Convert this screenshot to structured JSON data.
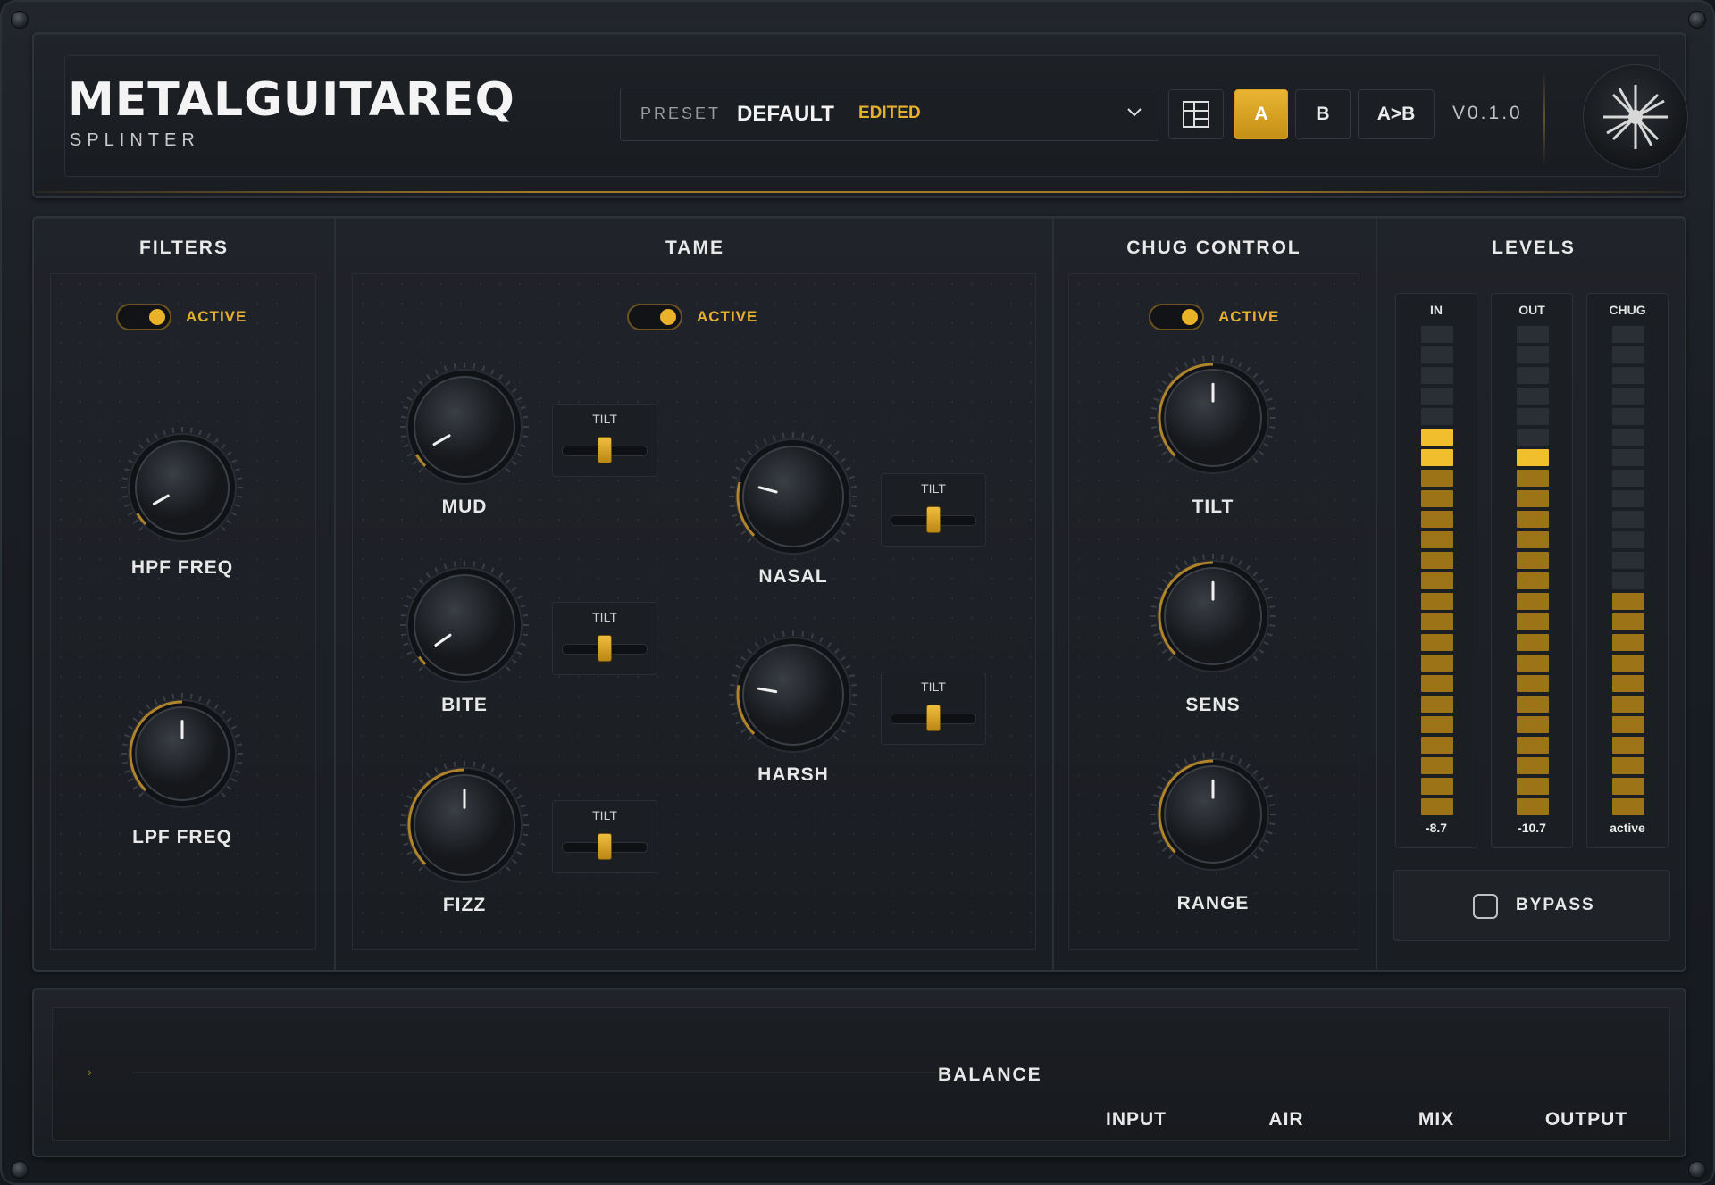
{
  "header": {
    "title": "METALGUITAREQ",
    "subtitle": "SPLINTER",
    "preset_label": "PRESET",
    "preset_name": "DEFAULT",
    "preset_status": "EDITED",
    "btn_a": "A",
    "btn_b": "B",
    "btn_ab": "A>B",
    "version": "V0.1.0"
  },
  "sections": {
    "filters": "FILTERS",
    "tame": "TAME",
    "chug": "CHUG CONTROL",
    "levels": "LEVELS"
  },
  "active_label": "ACTIVE",
  "tilt_label": "TILT",
  "knobs": {
    "hpf": "HPF FREQ",
    "lpf": "LPF FREQ",
    "mud": "MUD",
    "bite": "BITE",
    "fizz": "FIZZ",
    "nasal": "NASAL",
    "harsh": "HARSH",
    "chug_tilt": "TILT",
    "sens": "SENS",
    "range": "RANGE",
    "input": "INPUT",
    "air": "AIR",
    "mix": "MIX",
    "output": "OUTPUT"
  },
  "meters": {
    "in": {
      "label": "IN",
      "value": "-8.7"
    },
    "out": {
      "label": "OUT",
      "value": "-10.7"
    },
    "chug": {
      "label": "CHUG",
      "value": "active"
    }
  },
  "bypass_label": "BYPASS",
  "balance_label": "BALANCE",
  "colors": {
    "accent": "#e9b229",
    "panel": "#1c1f24"
  }
}
